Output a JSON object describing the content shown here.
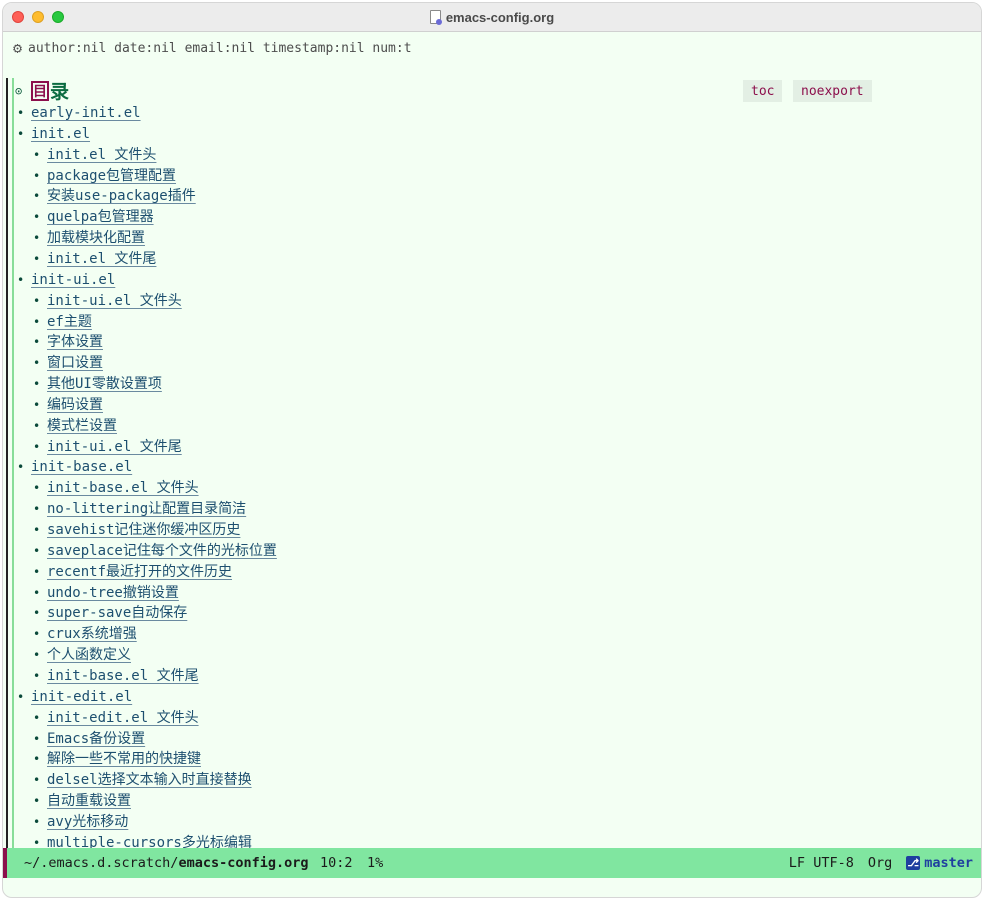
{
  "window": {
    "title": "emacs-config.org"
  },
  "header_line": {
    "text": "author:nil date:nil email:nil timestamp:nil num:t"
  },
  "heading": {
    "bullet": "⊙",
    "box_char": "目",
    "text": "录",
    "tags": [
      "toc",
      "noexport"
    ]
  },
  "toc": [
    {
      "level": 1,
      "text": "early-init.el"
    },
    {
      "level": 1,
      "text": "init.el"
    },
    {
      "level": 2,
      "text": "init.el 文件头"
    },
    {
      "level": 2,
      "text": "package包管理配置"
    },
    {
      "level": 2,
      "text": "安装use-package插件"
    },
    {
      "level": 2,
      "text": "quelpa包管理器"
    },
    {
      "level": 2,
      "text": "加载模块化配置"
    },
    {
      "level": 2,
      "text": "init.el 文件尾"
    },
    {
      "level": 1,
      "text": "init-ui.el"
    },
    {
      "level": 2,
      "text": "init-ui.el 文件头"
    },
    {
      "level": 2,
      "text": "ef主题"
    },
    {
      "level": 2,
      "text": "字体设置"
    },
    {
      "level": 2,
      "text": "窗口设置"
    },
    {
      "level": 2,
      "text": "其他UI零散设置项"
    },
    {
      "level": 2,
      "text": "编码设置"
    },
    {
      "level": 2,
      "text": "模式栏设置"
    },
    {
      "level": 2,
      "text": "init-ui.el 文件尾"
    },
    {
      "level": 1,
      "text": "init-base.el"
    },
    {
      "level": 2,
      "text": "init-base.el 文件头"
    },
    {
      "level": 2,
      "text": "no-littering让配置目录简洁"
    },
    {
      "level": 2,
      "text": "savehist记住迷你缓冲区历史"
    },
    {
      "level": 2,
      "text": "saveplace记住每个文件的光标位置"
    },
    {
      "level": 2,
      "text": "recentf最近打开的文件历史"
    },
    {
      "level": 2,
      "text": "undo-tree撤销设置"
    },
    {
      "level": 2,
      "text": "super-save自动保存"
    },
    {
      "level": 2,
      "text": "crux系统增强"
    },
    {
      "level": 2,
      "text": "个人函数定义"
    },
    {
      "level": 2,
      "text": "init-base.el 文件尾"
    },
    {
      "level": 1,
      "text": "init-edit.el"
    },
    {
      "level": 2,
      "text": "init-edit.el 文件头"
    },
    {
      "level": 2,
      "text": "Emacs备份设置"
    },
    {
      "level": 2,
      "text": "解除一些不常用的快捷键"
    },
    {
      "level": 2,
      "text": "delsel选择文本输入时直接替换"
    },
    {
      "level": 2,
      "text": "自动重载设置"
    },
    {
      "level": 2,
      "text": "avy光标移动"
    },
    {
      "level": 2,
      "text": "multiple-cursors多光标编辑"
    }
  ],
  "modeline": {
    "path_prefix": "~/.emacs.d.scratch/",
    "file_name": "emacs-config.org",
    "position": "10:2",
    "percent": "1%",
    "eol": "LF",
    "encoding": "UTF-8",
    "mode": "Org",
    "branch": "master"
  },
  "colors": {
    "background": "#f3fff3",
    "modeline": "#80e6a0",
    "link": "#1d4f6f",
    "heading": "#0a6b40",
    "tag": "#8c0f4c",
    "branch": "#1f3f9f"
  }
}
